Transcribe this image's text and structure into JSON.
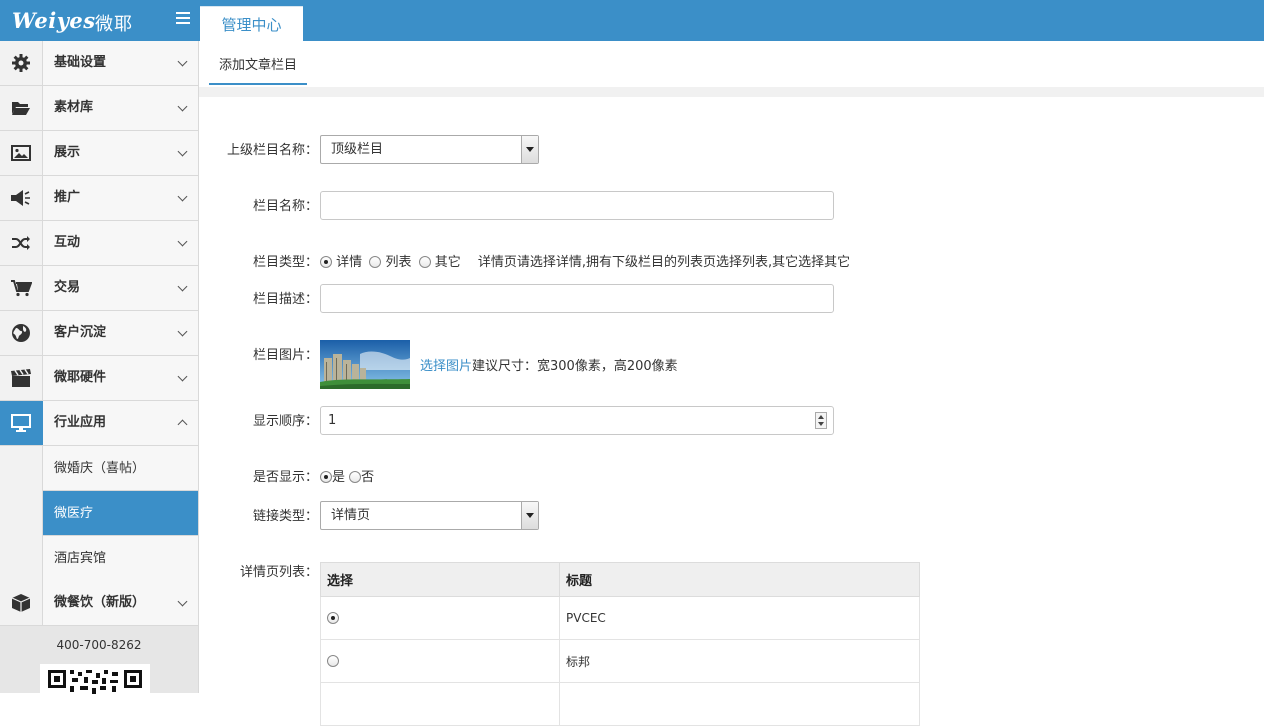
{
  "brand": {
    "logo_text": "Weiyes",
    "logo_cn": "微耶"
  },
  "top_tab": {
    "label": "管理中心"
  },
  "sidebar": {
    "items": [
      {
        "label": "基础设置",
        "icon": "gear-icon"
      },
      {
        "label": "素材库",
        "icon": "folder-icon"
      },
      {
        "label": "展示",
        "icon": "image-icon"
      },
      {
        "label": "推广",
        "icon": "megaphone-icon"
      },
      {
        "label": "互动",
        "icon": "shuffle-icon"
      },
      {
        "label": "交易",
        "icon": "cart-icon"
      },
      {
        "label": "客户沉淀",
        "icon": "globe-icon"
      },
      {
        "label": "微耶硬件",
        "icon": "clapperboard-icon"
      },
      {
        "label": "行业应用",
        "icon": "monitor-icon"
      },
      {
        "label": "微餐饮（新版）",
        "icon": "box-icon"
      }
    ],
    "sub_items": [
      {
        "label": "微婚庆（喜帖）"
      },
      {
        "label": "微医疗"
      },
      {
        "label": "酒店宾馆"
      }
    ],
    "phone": "400-700-8262"
  },
  "subnav": {
    "tab_label": "添加文章栏目"
  },
  "form": {
    "parent": {
      "label": "上级栏目名称：",
      "value": "顶级栏目"
    },
    "name": {
      "label": "栏目名称：",
      "value": ""
    },
    "type": {
      "label": "栏目类型：",
      "options": [
        "详情",
        "列表",
        "其它"
      ],
      "selected": "详情",
      "hint": "详情页请选择详情,拥有下级栏目的列表页选择列表,其它选择其它"
    },
    "desc": {
      "label": "栏目描述：",
      "value": ""
    },
    "image": {
      "label": "栏目图片：",
      "pick_text": "选择图片",
      "size_hint": "建议尺寸：宽300像素，高200像素"
    },
    "order": {
      "label": "显示顺序：",
      "value": "1"
    },
    "visible": {
      "label": "是否显示：",
      "yes": "是",
      "no": "否",
      "selected": "是"
    },
    "link_type": {
      "label": "链接类型：",
      "value": "详情页"
    },
    "detail_list": {
      "label": "详情页列表：",
      "columns": [
        "选择",
        "标题"
      ],
      "rows": [
        {
          "selected": true,
          "title": "PVCEC"
        },
        {
          "selected": false,
          "title": "标邦"
        }
      ]
    }
  }
}
